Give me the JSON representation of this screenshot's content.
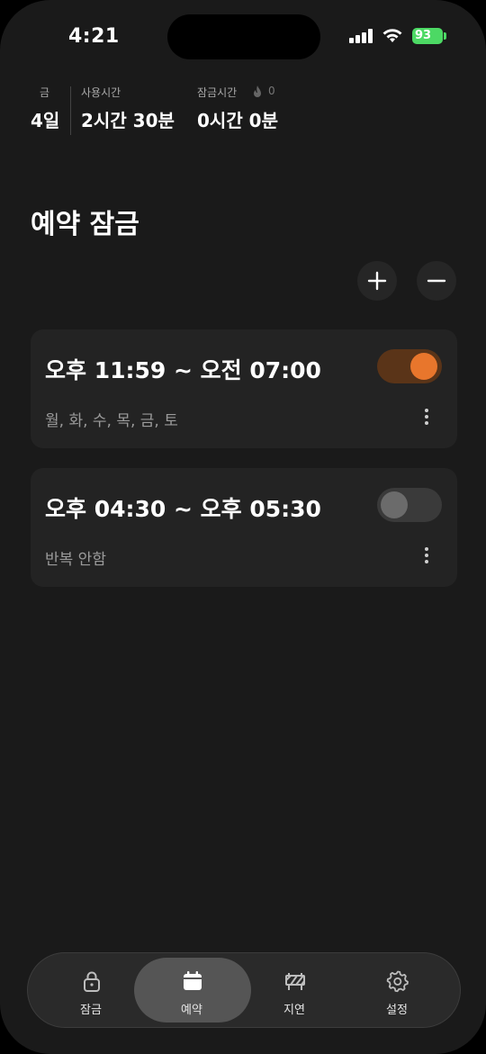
{
  "status_bar": {
    "time": "4:21",
    "battery": "93"
  },
  "stats": {
    "day_label": "금",
    "day_value": "4일",
    "usage_label": "사용시간",
    "usage_value": "2시간 30분",
    "lock_label": "잠금시간",
    "lock_value": "0시간 0분",
    "fire_count": "0"
  },
  "page": {
    "title": "예약 잠금"
  },
  "schedules": [
    {
      "time_range": "오후 11:59 ~ 오전 07:00",
      "repeat": "월, 화, 수, 목, 금, 토",
      "enabled": true
    },
    {
      "time_range": "오후 04:30 ~ 오후 05:30",
      "repeat": "반복 안함",
      "enabled": false
    }
  ],
  "tabs": [
    {
      "label": "잠금",
      "icon": "lock-icon",
      "active": false
    },
    {
      "label": "예약",
      "icon": "calendar-icon",
      "active": true
    },
    {
      "label": "지연",
      "icon": "barrier-icon",
      "active": false
    },
    {
      "label": "설정",
      "icon": "gear-icon",
      "active": false
    }
  ],
  "colors": {
    "accent": "#e8762c",
    "toggle_on_track": "#5a3418",
    "toggle_off_track": "#3a3a3a",
    "background": "#1a1a1a",
    "card": "#232323"
  }
}
